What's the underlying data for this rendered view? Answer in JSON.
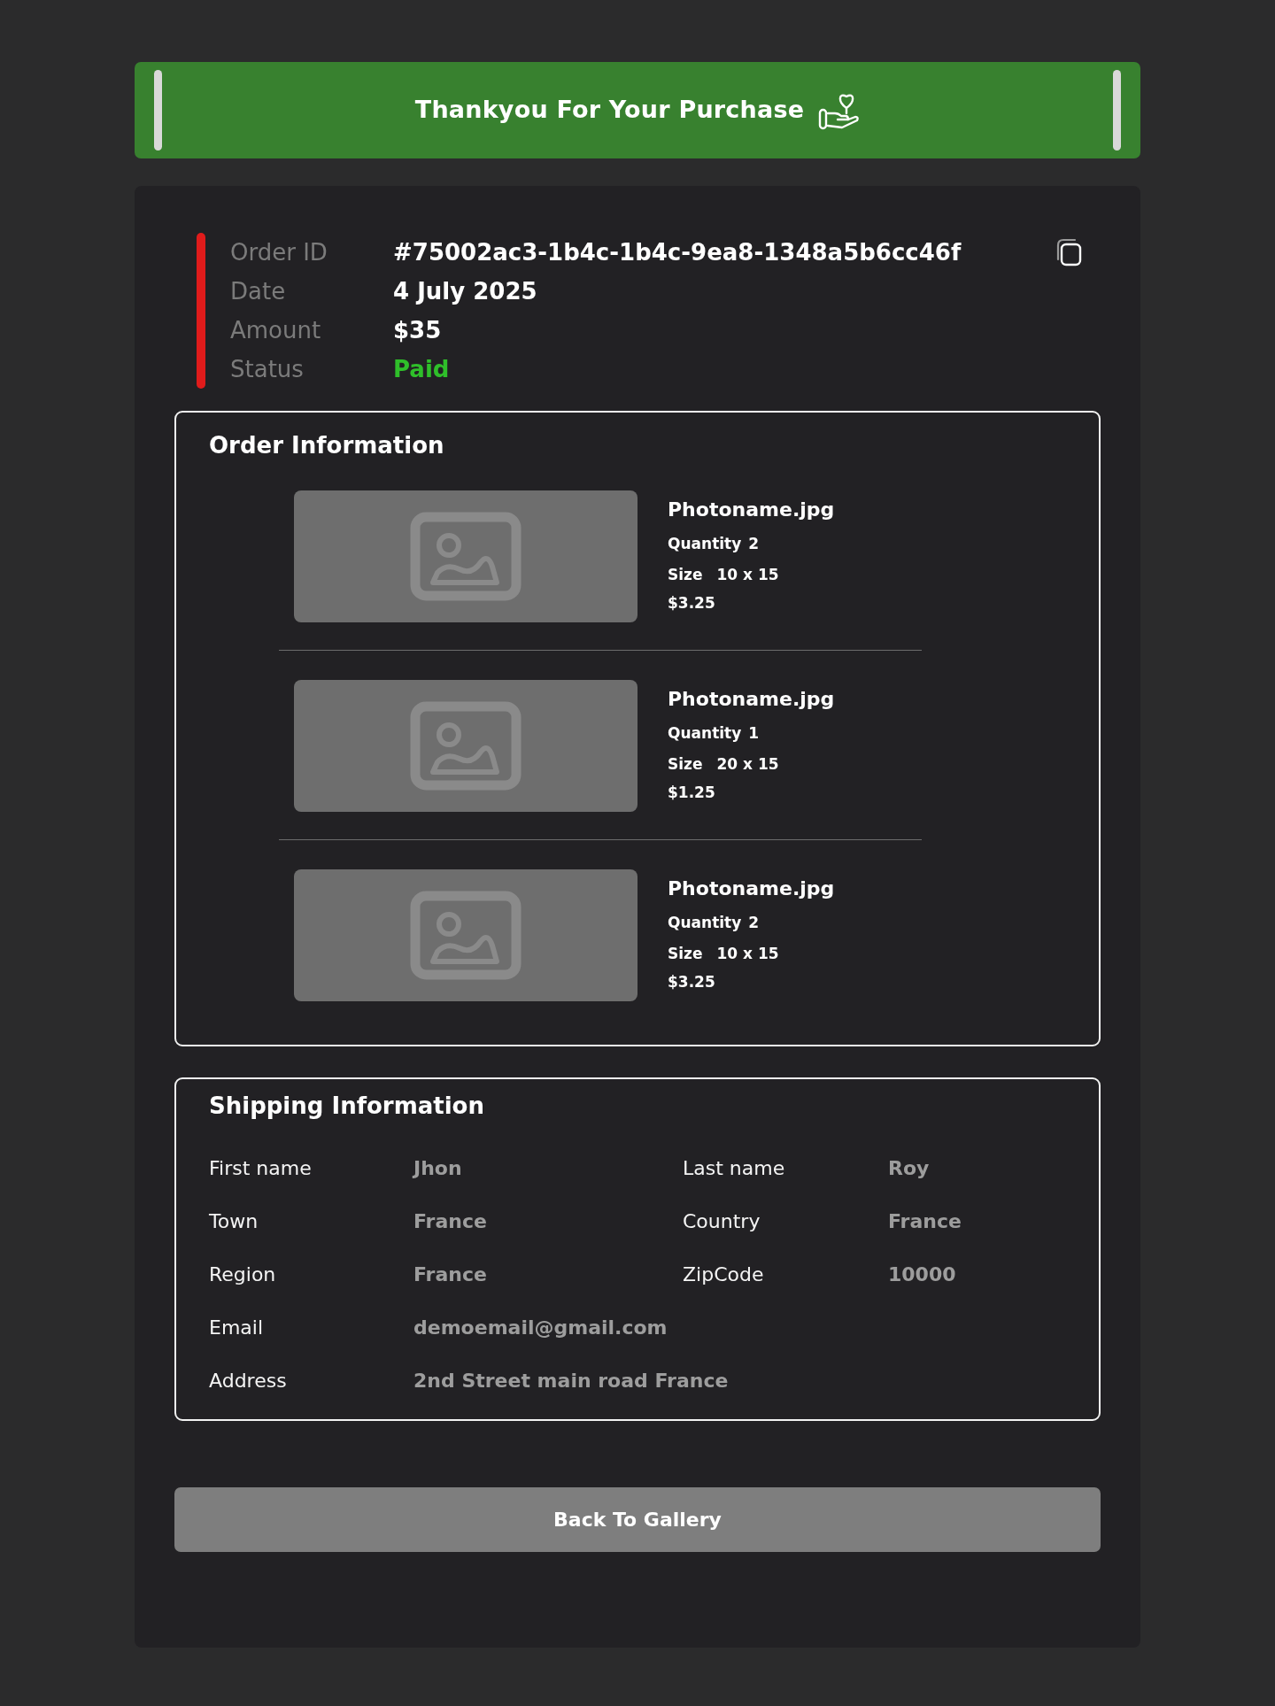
{
  "banner": {
    "title": "Thankyou For Your Purchase"
  },
  "order_summary": {
    "rows": [
      {
        "kind": "id",
        "label": "Order ID",
        "value": "#75002ac3-1b4c-1b4c-9ea8-1348a5b6cc46f"
      },
      {
        "kind": "text",
        "label": "Date",
        "value": "4 July 2025"
      },
      {
        "kind": "text",
        "label": "Amount",
        "value": "$35"
      },
      {
        "kind": "status",
        "label": "Status",
        "value": "Paid"
      }
    ]
  },
  "order_information": {
    "title": "Order Information",
    "items": [
      {
        "name": "Photoname.jpg",
        "quantity_label": "Quantity",
        "quantity": "2",
        "size_label": "Size",
        "size": "10 x 15",
        "price": "$3.25"
      },
      {
        "name": "Photoname.jpg",
        "quantity_label": "Quantity",
        "quantity": "1",
        "size_label": "Size",
        "size": "20 x 15",
        "price": "$1.25"
      },
      {
        "name": "Photoname.jpg",
        "quantity_label": "Quantity",
        "quantity": "2",
        "size_label": "Size",
        "size": "10 x 15",
        "price": "$3.25"
      }
    ]
  },
  "shipping_information": {
    "title": "Shipping Information",
    "rows": [
      [
        {
          "label": "First name",
          "value": "Jhon"
        },
        {
          "label": "Last name",
          "value": "Roy"
        }
      ],
      [
        {
          "label": "Town",
          "value": "France"
        },
        {
          "label": "Country",
          "value": "France"
        }
      ],
      [
        {
          "label": "Region",
          "value": "France"
        },
        {
          "label": "ZipCode",
          "value": "10000"
        }
      ],
      [
        {
          "label": "Email",
          "value": "demoemail@gmail.com"
        }
      ],
      [
        {
          "label": "Address",
          "value": "2nd Street main road France"
        }
      ]
    ]
  },
  "back_button": {
    "label": "Back To Gallery"
  }
}
